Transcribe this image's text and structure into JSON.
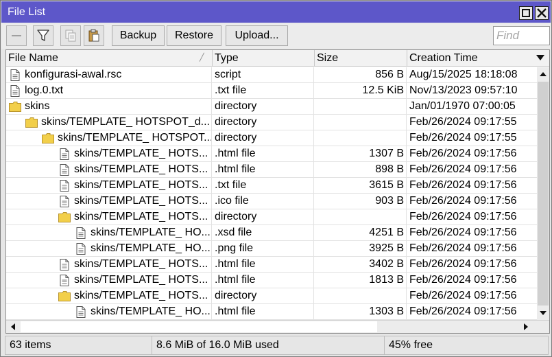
{
  "window": {
    "title": "File List"
  },
  "toolbar": {
    "backup_label": "Backup",
    "restore_label": "Restore",
    "upload_label": "Upload...",
    "find_placeholder": "Find"
  },
  "columns": {
    "name": "File Name",
    "type": "Type",
    "size": "Size",
    "time": "Creation Time"
  },
  "rows": [
    {
      "name": "konfigurasi-awal.rsc",
      "icon": "file-icon",
      "indent": 0,
      "type": "script",
      "size": "856 B",
      "time": "Aug/15/2025 18:18:08"
    },
    {
      "name": "log.0.txt",
      "icon": "file-icon",
      "indent": 0,
      "type": ".txt file",
      "size": "12.5 KiB",
      "time": "Nov/13/2023 09:57:10"
    },
    {
      "name": "skins",
      "icon": "folder-icon",
      "indent": 0,
      "type": "directory",
      "size": "",
      "time": "Jan/01/1970 07:00:05"
    },
    {
      "name": "skins/TEMPLATE_ HOTSPOT_d...",
      "icon": "folder-icon",
      "indent": 1,
      "type": "directory",
      "size": "",
      "time": "Feb/26/2024 09:17:55"
    },
    {
      "name": "skins/TEMPLATE_ HOTSPOT...",
      "icon": "folder-icon",
      "indent": 2,
      "type": "directory",
      "size": "",
      "time": "Feb/26/2024 09:17:55"
    },
    {
      "name": "skins/TEMPLATE_ HOTS...",
      "icon": "file-icon",
      "indent": 3,
      "type": ".html file",
      "size": "1307 B",
      "time": "Feb/26/2024 09:17:56"
    },
    {
      "name": "skins/TEMPLATE_ HOTS...",
      "icon": "file-icon",
      "indent": 3,
      "type": ".html file",
      "size": "898 B",
      "time": "Feb/26/2024 09:17:56"
    },
    {
      "name": "skins/TEMPLATE_ HOTS...",
      "icon": "file-icon",
      "indent": 3,
      "type": ".txt file",
      "size": "3615 B",
      "time": "Feb/26/2024 09:17:56"
    },
    {
      "name": "skins/TEMPLATE_ HOTS...",
      "icon": "file-icon",
      "indent": 3,
      "type": ".ico file",
      "size": "903 B",
      "time": "Feb/26/2024 09:17:56"
    },
    {
      "name": "skins/TEMPLATE_ HOTS...",
      "icon": "folder-icon",
      "indent": 3,
      "type": "directory",
      "size": "",
      "time": "Feb/26/2024 09:17:56"
    },
    {
      "name": "skins/TEMPLATE_ HO...",
      "icon": "file-icon",
      "indent": 4,
      "type": ".xsd file",
      "size": "4251 B",
      "time": "Feb/26/2024 09:17:56"
    },
    {
      "name": "skins/TEMPLATE_ HO...",
      "icon": "file-icon",
      "indent": 4,
      "type": ".png file",
      "size": "3925 B",
      "time": "Feb/26/2024 09:17:56"
    },
    {
      "name": "skins/TEMPLATE_ HOTS...",
      "icon": "file-icon",
      "indent": 3,
      "type": ".html file",
      "size": "3402 B",
      "time": "Feb/26/2024 09:17:56"
    },
    {
      "name": "skins/TEMPLATE_ HOTS...",
      "icon": "file-icon",
      "indent": 3,
      "type": ".html file",
      "size": "1813 B",
      "time": "Feb/26/2024 09:17:56"
    },
    {
      "name": "skins/TEMPLATE_ HOTS...",
      "icon": "folder-icon",
      "indent": 3,
      "type": "directory",
      "size": "",
      "time": "Feb/26/2024 09:17:56"
    },
    {
      "name": "skins/TEMPLATE_ HO...",
      "icon": "file-icon",
      "indent": 4,
      "type": ".html file",
      "size": "1303 B",
      "time": "Feb/26/2024 09:17:56"
    }
  ],
  "status": {
    "items": "63 items",
    "usage": "8.6 MiB of 16.0 MiB used",
    "free": "45% free"
  },
  "colors": {
    "titlebar": "#5d57c9",
    "folder": "#f2cf4a",
    "folder_border": "#b8932a"
  }
}
